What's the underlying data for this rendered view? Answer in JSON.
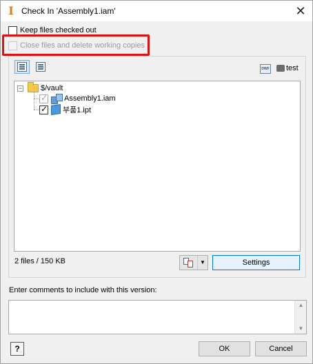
{
  "window": {
    "title": "Check In 'Assembly1.iam'",
    "app_icon_glyph": "I",
    "close_glyph": "✕"
  },
  "options": {
    "keep_checked_out": {
      "label": "Keep files checked out",
      "checked": false
    },
    "close_and_delete": {
      "label": "Close files and delete working copies",
      "checked": false,
      "disabled": true
    }
  },
  "toolbar": {
    "dwf_icon_text": "DWF",
    "vault_name": "test"
  },
  "tree": {
    "root": {
      "label": "$/vault",
      "expander": "−"
    },
    "items": [
      {
        "label": "Assembly1.iam",
        "checked": true,
        "disabled": true,
        "icon": "assembly-icon"
      },
      {
        "label": "부품1.ipt",
        "checked": true,
        "disabled": false,
        "icon": "part-icon"
      }
    ]
  },
  "status": {
    "files_count": "2 files / 150 KB"
  },
  "buttons": {
    "split_drop_glyph": "▼",
    "settings": "Settings",
    "ok": "OK",
    "cancel": "Cancel",
    "help_glyph": "?"
  },
  "comments": {
    "label": "Enter comments to include with this version:",
    "value": "",
    "scroll_up": "▲",
    "scroll_down": "▼"
  },
  "colors": {
    "highlight": "#e01010",
    "accent": "#0078d7",
    "app_icon": "#e07a10"
  }
}
